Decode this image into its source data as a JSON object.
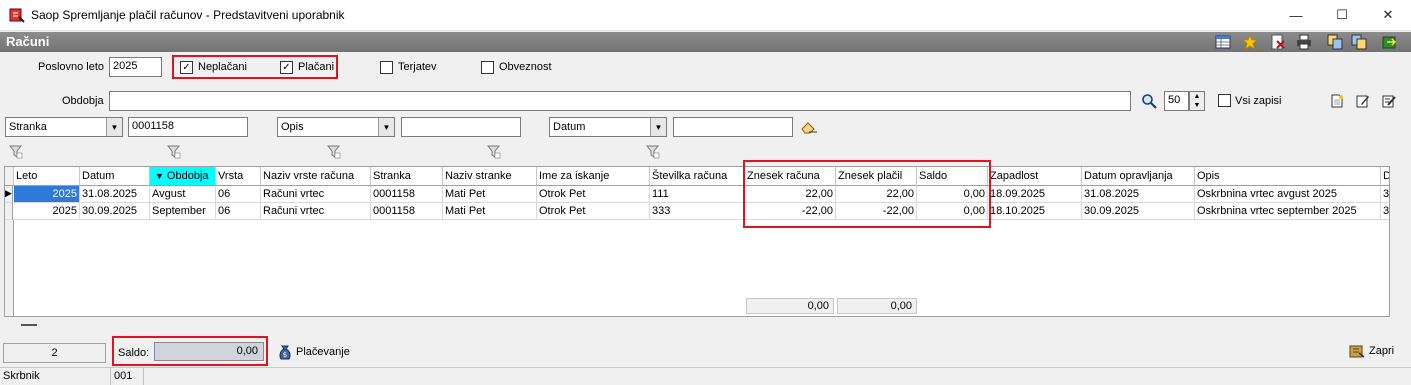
{
  "window": {
    "title": "Saop Spremljanje plačil računov - Predstavitveni uporabnik",
    "minimize": "—",
    "maximize": "☐",
    "close": "✕"
  },
  "header": {
    "title": "Računi"
  },
  "filters": {
    "poslovno_leto_label": "Poslovno leto",
    "poslovno_leto_value": "2025",
    "neplacani_label": "Neplačani",
    "placani_label": "Plačani",
    "terjatev_label": "Terjatev",
    "obveznost_label": "Obveznost",
    "obdobja_label": "Obdobja",
    "obdobja_value": "",
    "limit_value": "50",
    "vsi_zapisi_label": "Vsi zapisi",
    "combo1_selected": "Stranka",
    "combo1_value": "0001158",
    "combo2_selected": "Opis",
    "combo2_value": "",
    "combo3_selected": "Datum",
    "combo3_value": ""
  },
  "table": {
    "columns": [
      "Leto",
      "Datum",
      "Obdobja",
      "Vrsta",
      "Naziv vrste računa",
      "Stranka",
      "Naziv stranke",
      "Ime za iskanje",
      "Številka računa",
      "Znesek računa",
      "Znesek plačil",
      "Saldo",
      "Zapadlost",
      "Datum opravljanja",
      "Opis",
      "D"
    ],
    "rows": [
      [
        "2025",
        "31.08.2025",
        "Avgust",
        "06",
        "Računi vrtec",
        "0001158",
        "Mati Pet",
        "Otrok Pet",
        "111",
        "22,00",
        "22,00",
        "0,00",
        "18.09.2025",
        "31.08.2025",
        "Oskrbnina vrtec avgust 2025",
        "3"
      ],
      [
        "2025",
        "30.09.2025",
        "September",
        "06",
        "Računi vrtec",
        "0001158",
        "Mati Pet",
        "Otrok Pet",
        "333",
        "-22,00",
        "-22,00",
        "0,00",
        "18.10.2025",
        "30.09.2025",
        "Oskrbnina vrtec september 2025",
        "3"
      ]
    ],
    "sum_znesek_racuna": "0,00",
    "sum_znesek_placil": "0,00"
  },
  "footer": {
    "record_count": "2",
    "saldo_label": "Saldo:",
    "saldo_value": "0,00",
    "placevanje_label": "Plačevanje",
    "zapri_label": "Zapri"
  },
  "statusbar": {
    "user": "Skrbnik",
    "code": "001"
  },
  "colors": {
    "header_band": "#808080",
    "highlight": "#e0141e",
    "sort_column": "#00ffff"
  }
}
